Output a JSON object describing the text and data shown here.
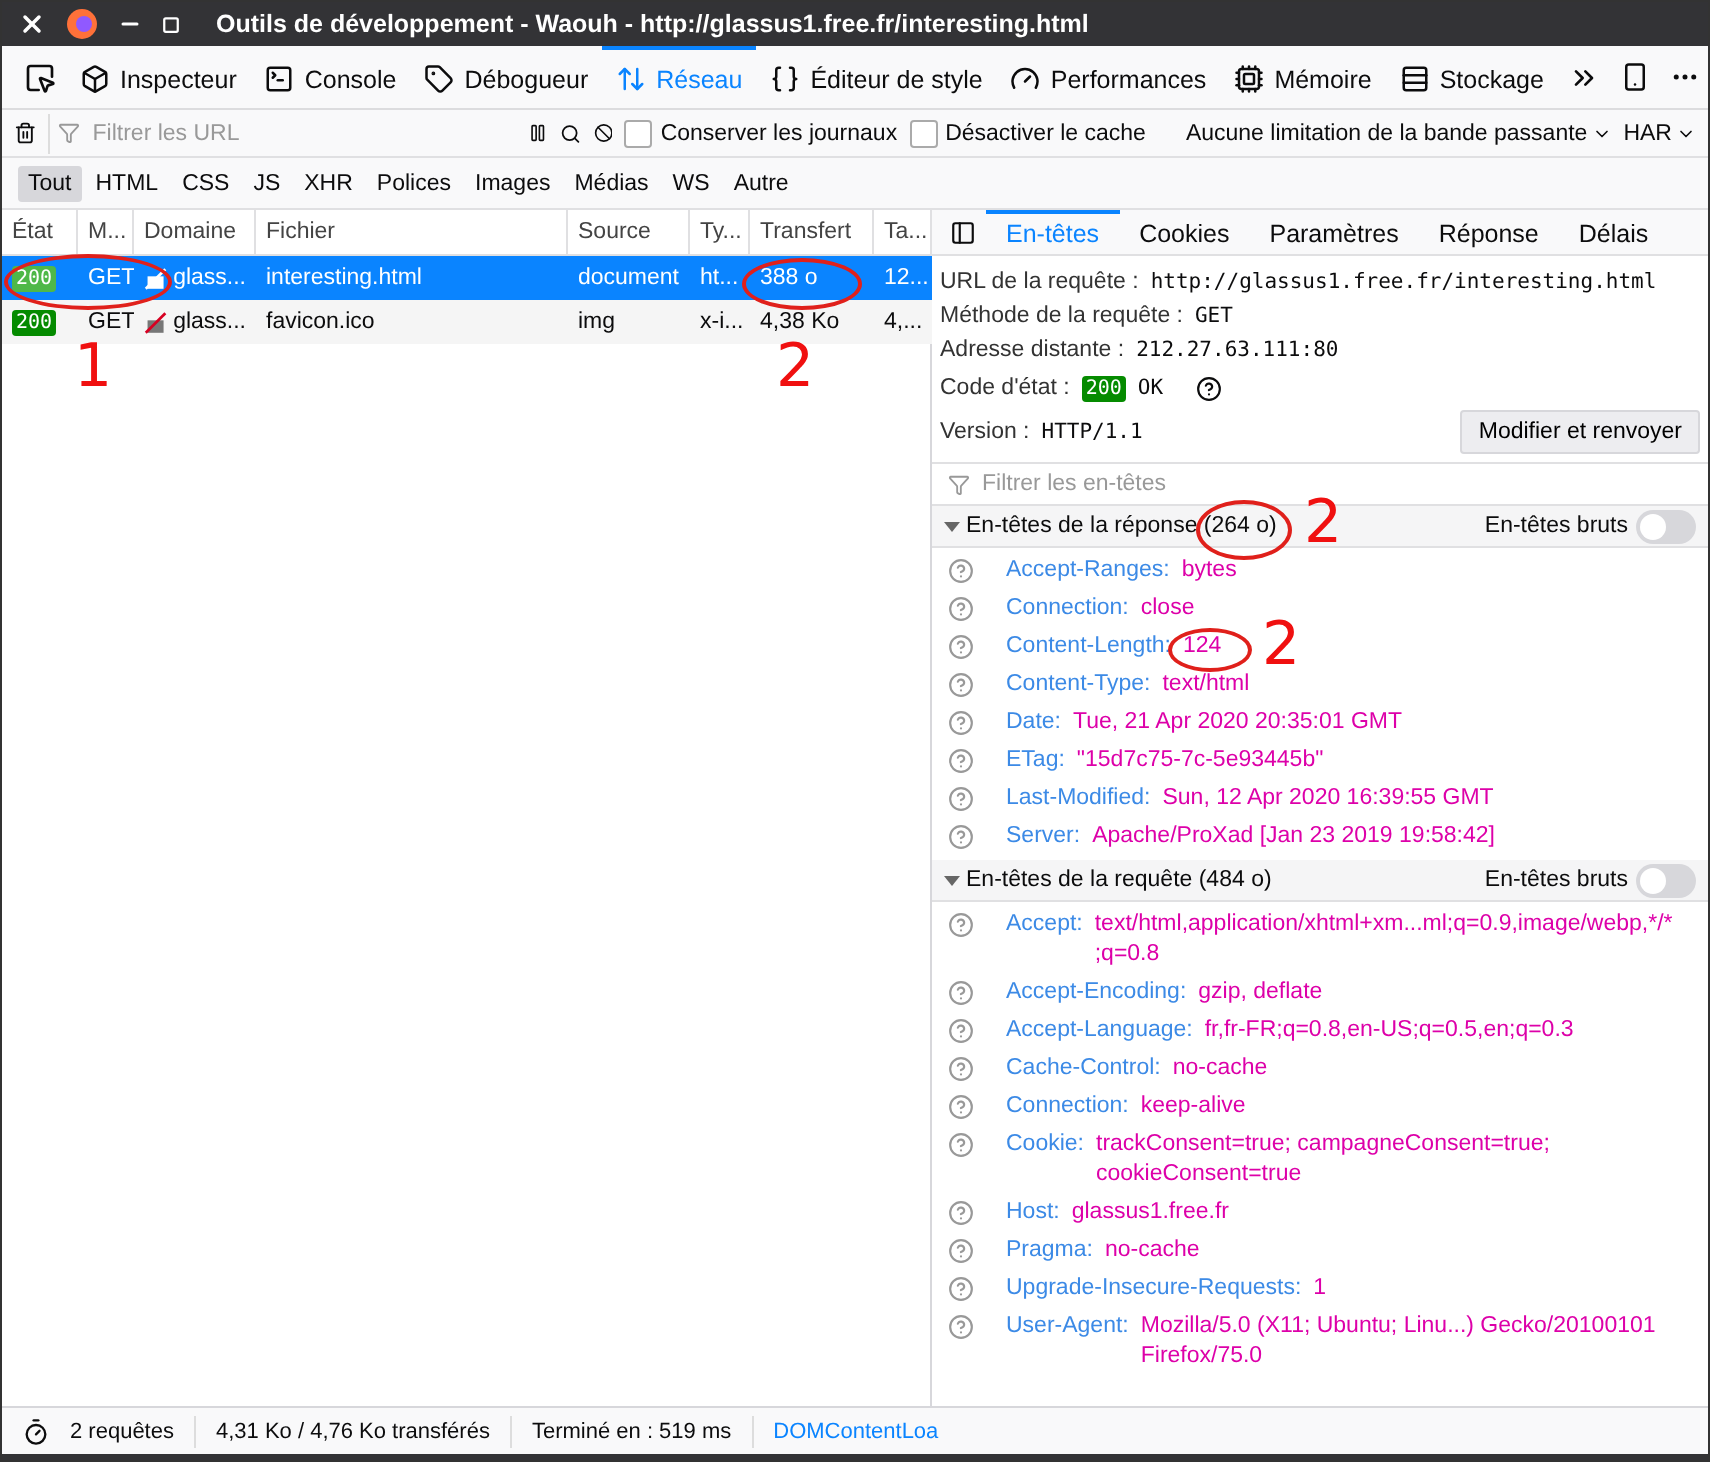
{
  "window": {
    "title": "Outils de développement - Waouh - http://glassus1.free.fr/interesting.html"
  },
  "toolbar_tabs": [
    {
      "label": "Inspecteur",
      "selected": false
    },
    {
      "label": "Console",
      "selected": false
    },
    {
      "label": "Débogueur",
      "selected": false
    },
    {
      "label": "Réseau",
      "selected": true
    },
    {
      "label": "Éditeur de style",
      "selected": false
    },
    {
      "label": "Performances",
      "selected": false
    },
    {
      "label": "Mémoire",
      "selected": false
    },
    {
      "label": "Stockage",
      "selected": false
    }
  ],
  "filter_bar": {
    "placeholder": "Filtrer les URL",
    "checkboxes": [
      {
        "label": "Conserver les journaux",
        "checked": false
      },
      {
        "label": "Désactiver le cache",
        "checked": false
      }
    ],
    "throttling": "Aucune limitation de la bande passante",
    "har": "HAR"
  },
  "type_filters": [
    {
      "label": "Tout",
      "selected": true
    },
    {
      "label": "HTML",
      "selected": false
    },
    {
      "label": "CSS",
      "selected": false
    },
    {
      "label": "JS",
      "selected": false
    },
    {
      "label": "XHR",
      "selected": false
    },
    {
      "label": "Polices",
      "selected": false
    },
    {
      "label": "Images",
      "selected": false
    },
    {
      "label": "Médias",
      "selected": false
    },
    {
      "label": "WS",
      "selected": false
    },
    {
      "label": "Autre",
      "selected": false
    }
  ],
  "requests_table": {
    "columns": [
      "État",
      "M...",
      "Domaine",
      "Fichier",
      "Source",
      "Ty...",
      "Transfert",
      "Ta..."
    ],
    "rows": [
      {
        "status": "200",
        "method": "GET",
        "domain": "glass...",
        "file": "interesting.html",
        "source": "document",
        "type": "ht...",
        "transferred": "388 o",
        "size": "12...",
        "selected": true
      },
      {
        "status": "200",
        "method": "GET",
        "domain": "glass...",
        "file": "favicon.ico",
        "source": "img",
        "type": "x-i...",
        "transferred": "4,38 Ko",
        "size": "4,...",
        "selected": false
      }
    ]
  },
  "details": {
    "tabs": [
      {
        "label": "En-têtes",
        "selected": true
      },
      {
        "label": "Cookies",
        "selected": false
      },
      {
        "label": "Paramètres",
        "selected": false
      },
      {
        "label": "Réponse",
        "selected": false
      },
      {
        "label": "Délais",
        "selected": false
      }
    ],
    "summary": [
      {
        "label": "URL de la requête :",
        "value": "http://glassus1.free.fr/interesting.html"
      },
      {
        "label": "Méthode de la requête :",
        "value": "GET"
      },
      {
        "label": "Adresse distante :",
        "value": "212.27.63.111:80"
      }
    ],
    "status_code": {
      "label": "Code d'état :",
      "code": "200",
      "text": "OK"
    },
    "version": {
      "label": "Version :",
      "value": "HTTP/1.1"
    },
    "resend_button": "Modifier et renvoyer",
    "filter_placeholder": "Filtrer les en-têtes",
    "sections": [
      {
        "title": "En-têtes de la réponse (264 o)",
        "expanded": true,
        "raw_label": "En-têtes bruts",
        "raw_on": false,
        "headers": [
          {
            "name": "Accept-Ranges:",
            "value": "bytes"
          },
          {
            "name": "Connection:",
            "value": "close"
          },
          {
            "name": "Content-Length:",
            "value": "124"
          },
          {
            "name": "Content-Type:",
            "value": "text/html"
          },
          {
            "name": "Date:",
            "value": "Tue, 21 Apr 2020 20:35:01 GMT"
          },
          {
            "name": "ETag:",
            "value": "\"15d7c75-7c-5e93445b\""
          },
          {
            "name": "Last-Modified:",
            "value": "Sun, 12 Apr 2020 16:39:55 GMT"
          },
          {
            "name": "Server:",
            "value": "Apache/ProXad [Jan 23 2019 19:58:42]"
          }
        ]
      },
      {
        "title": "En-têtes de la requête (484 o)",
        "expanded": true,
        "raw_label": "En-têtes bruts",
        "raw_on": false,
        "headers": [
          {
            "name": "Accept:",
            "value": "text/html,application/xhtml+xm...ml;q=0.9,image/webp,*/*;q=0.8"
          },
          {
            "name": "Accept-Encoding:",
            "value": "gzip, deflate"
          },
          {
            "name": "Accept-Language:",
            "value": "fr,fr-FR;q=0.8,en-US;q=0.5,en;q=0.3"
          },
          {
            "name": "Cache-Control:",
            "value": "no-cache"
          },
          {
            "name": "Connection:",
            "value": "keep-alive"
          },
          {
            "name": "Cookie:",
            "value": "trackConsent=true; campagneConsent=true; cookieConsent=true"
          },
          {
            "name": "Host:",
            "value": "glassus1.free.fr"
          },
          {
            "name": "Pragma:",
            "value": "no-cache"
          },
          {
            "name": "Upgrade-Insecure-Requests:",
            "value": "1"
          },
          {
            "name": "User-Agent:",
            "value": "Mozilla/5.0 (X11; Ubuntu; Linu...) Gecko/20100101 Firefox/75.0"
          }
        ]
      }
    ]
  },
  "status_bar": {
    "requests": "2 requêtes",
    "transferred": "4,31 Ko / 4,76 Ko transférés",
    "finished": "Terminé en : 519 ms",
    "dom_content_loaded": "DOMContentLoa"
  },
  "annotations": [
    {
      "label": "1"
    },
    {
      "label": "2"
    },
    {
      "label": "2"
    },
    {
      "label": "2"
    }
  ]
}
